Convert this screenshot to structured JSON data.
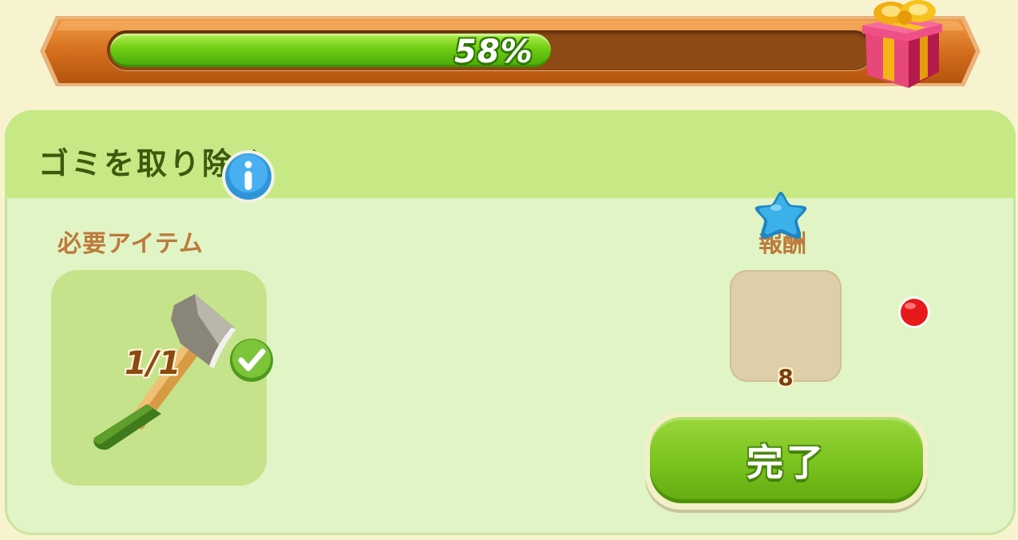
{
  "progress": {
    "percent": 58,
    "label": "58%",
    "fill_color": "#6fcd12",
    "track_color": "#8e4a14",
    "end_icon": "gift-box-icon"
  },
  "task": {
    "title": "ゴミを取り除く",
    "required_items_label": "必要アイテム",
    "required_item": {
      "icon": "axe-icon",
      "count": "1/1",
      "completed": true,
      "info_icon": "info-icon",
      "check_icon": "checkmark-icon"
    },
    "reward_label": "報酬",
    "reward": {
      "icon": "blue-star-gem-icon",
      "amount": "8"
    },
    "complete_button_label": "完了",
    "notification_dot": true
  },
  "colors": {
    "background": "#f8f3cf",
    "panel": "#e0f4c6",
    "header": "#c6e985",
    "title_text": "#3c5a0e",
    "section_text": "#bd7a3a",
    "button_green": "#7cc41f",
    "notify_red": "#e8191c"
  }
}
